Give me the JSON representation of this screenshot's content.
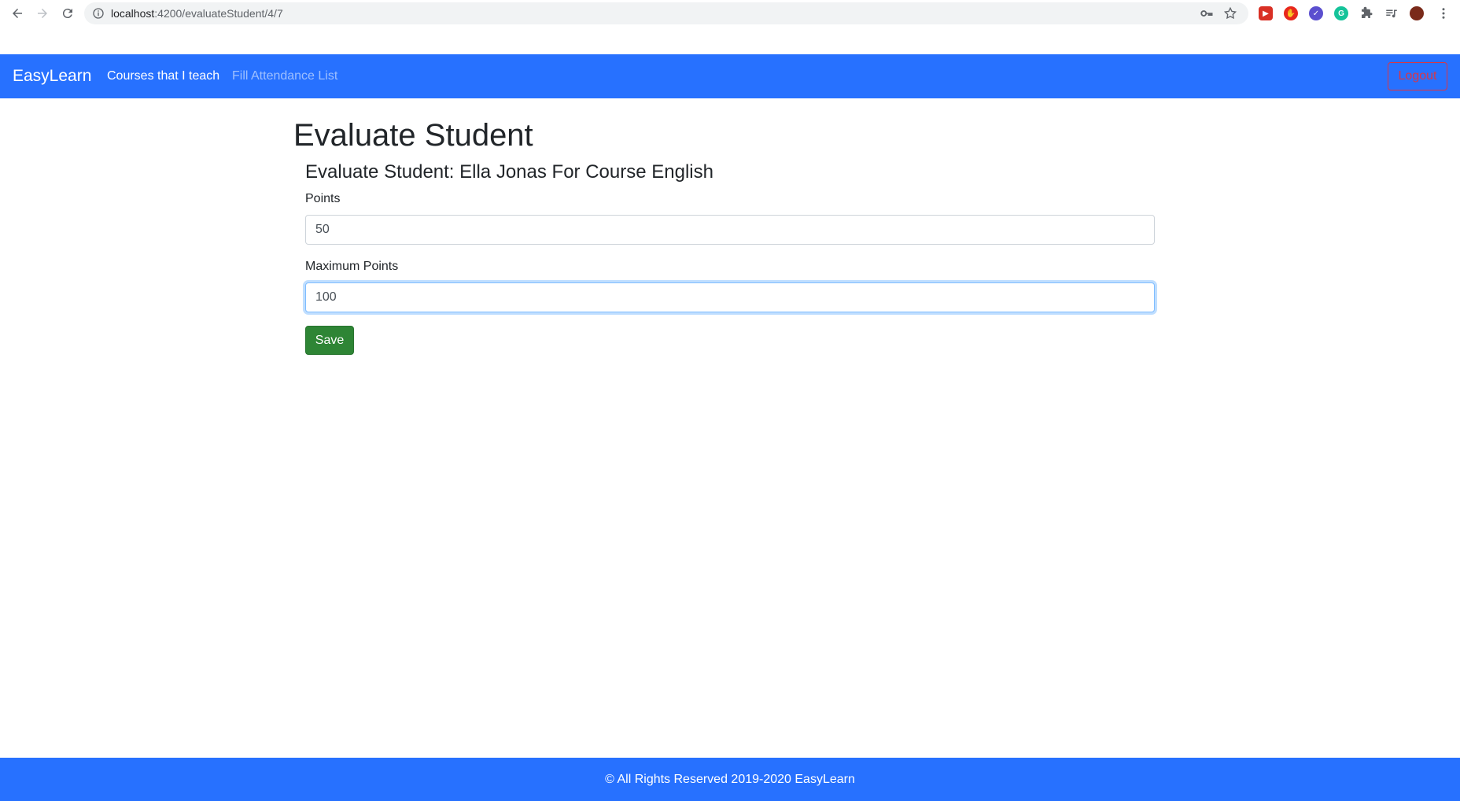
{
  "browser": {
    "url_host": "localhost",
    "url_path": ":4200/evaluateStudent/4/7",
    "icons": {
      "back": "arrow-left-icon",
      "forward": "arrow-right-icon",
      "reload": "reload-icon",
      "site_info": "info-icon",
      "password": "key-icon",
      "bookmark": "star-icon",
      "menu": "kebab-menu-icon"
    },
    "extensions": [
      {
        "name": "red-play-extension-icon",
        "color": "#d93025"
      },
      {
        "name": "hand-stop-extension-icon",
        "color": "#e8271c"
      },
      {
        "name": "purple-check-extension-icon",
        "color": "#5b4fcf"
      },
      {
        "name": "grammarly-extension-icon",
        "color": "#15c39a"
      },
      {
        "name": "puzzle-extensions-icon",
        "color": "#5f6368"
      },
      {
        "name": "media-queue-icon",
        "color": "#5f6368"
      },
      {
        "name": "profile-avatar",
        "color": "#7a2a1a"
      }
    ]
  },
  "navbar": {
    "brand": "EasyLearn",
    "links": [
      "Courses that I teach",
      "Fill Attendance List"
    ],
    "logout_label": "Logout",
    "color": "#2771ff"
  },
  "main": {
    "title": "Evaluate Student",
    "subtitle": "Evaluate Student: Ella Jonas For Course English",
    "fields": [
      {
        "label": "Points",
        "value": "50"
      },
      {
        "label": "Maximum Points",
        "value": "100"
      }
    ],
    "save_label": "Save"
  },
  "footer": {
    "text": "© All Rights Reserved 2019-2020 EasyLearn"
  }
}
